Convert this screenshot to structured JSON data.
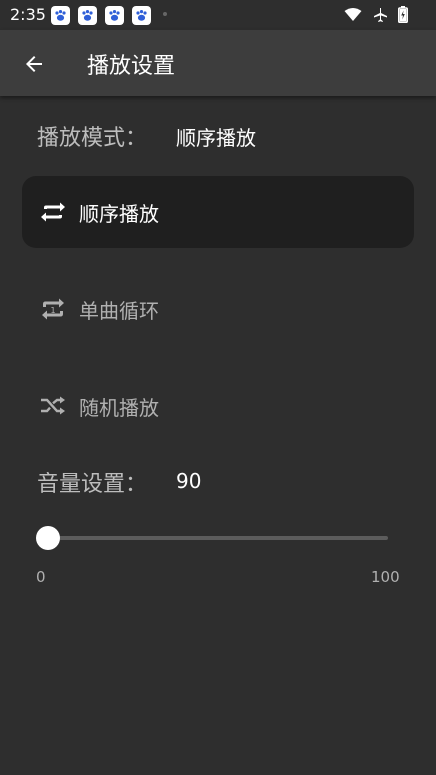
{
  "status_bar": {
    "time": "2:35",
    "notification_icons": [
      "baidu-paw-icon",
      "baidu-paw-icon",
      "baidu-paw-icon",
      "baidu-paw-icon"
    ],
    "system_icons": [
      "wifi-icon",
      "airplane-mode-icon",
      "battery-charging-icon"
    ]
  },
  "app_bar": {
    "title": "播放设置",
    "back_icon": "arrow-left-icon"
  },
  "play_mode": {
    "label": "播放模式：",
    "current_value": "顺序播放",
    "options": [
      {
        "label": "顺序播放",
        "icon": "repeat-icon",
        "selected": true
      },
      {
        "label": "单曲循环",
        "icon": "repeat-one-icon",
        "selected": false
      },
      {
        "label": "随机播放",
        "icon": "shuffle-icon",
        "selected": false
      }
    ]
  },
  "volume": {
    "label": "音量设置：",
    "value": "90",
    "slider_min": "0",
    "slider_max": "100"
  },
  "colors": {
    "background": "#2e2e2e",
    "app_bar": "#3d3d3d",
    "selected_option": "#1f1f1f",
    "accent": "#ffffff"
  }
}
